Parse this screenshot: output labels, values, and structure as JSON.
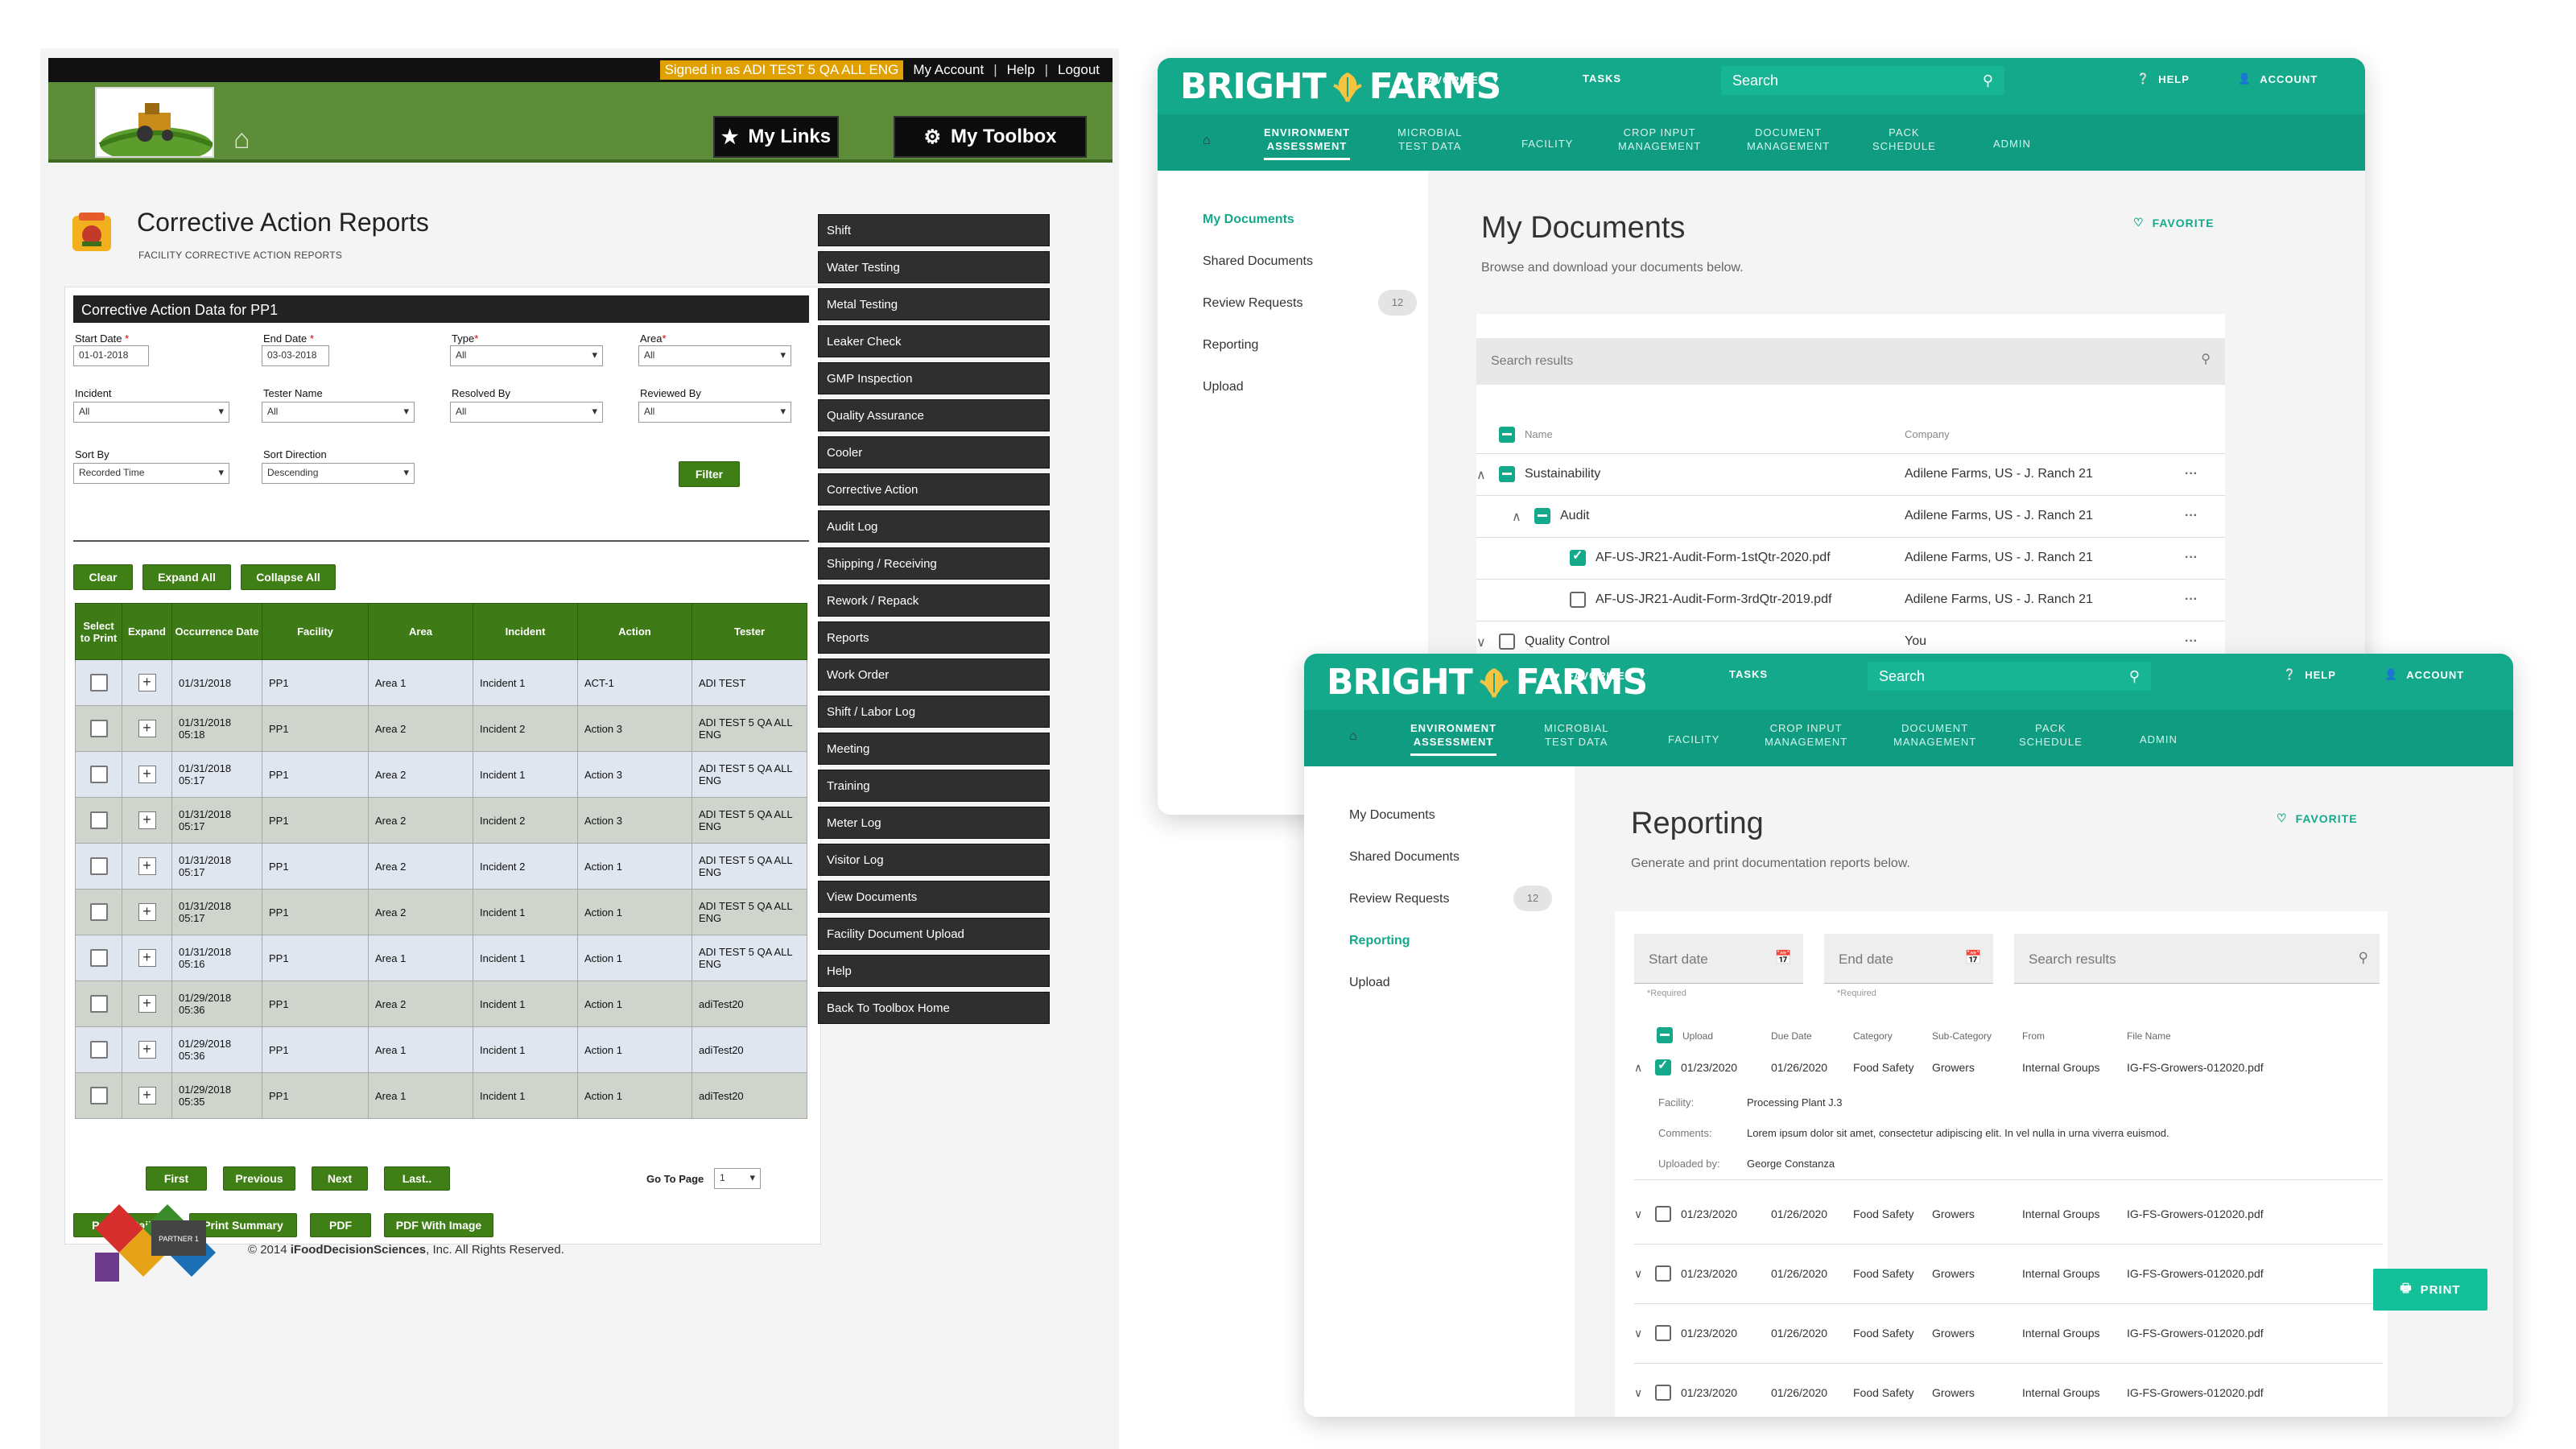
{
  "legacy": {
    "topbar": {
      "signed": "Signed in as ADI TEST 5 QA ALL ENG",
      "account": "My Account",
      "help": "Help",
      "logout": "Logout"
    },
    "mylinks": "My Links",
    "mytoolbox": "My Toolbox",
    "title": "Corrective Action Reports",
    "subtitle": "FACILITY CORRECTIVE ACTION REPORTS",
    "form_header": "Corrective Action Data for PP1",
    "fields": {
      "start_label": "Start Date",
      "start_value": "01-01-2018",
      "end_label": "End Date",
      "end_value": "03-03-2018",
      "type_label": "Type",
      "type_value": "All",
      "area_label": "Area",
      "area_value": "All",
      "incident_label": "Incident",
      "incident_value": "All",
      "tester_label": "Tester Name",
      "tester_value": "All",
      "resolved_label": "Resolved By",
      "resolved_value": "All",
      "reviewed_label": "Reviewed By",
      "reviewed_value": "All",
      "sortby_label": "Sort By",
      "sortby_value": "Recorded Time",
      "sortdir_label": "Sort Direction",
      "sortdir_value": "Descending",
      "required_mark": "*"
    },
    "buttons": {
      "filter": "Filter",
      "clear": "Clear",
      "expand": "Expand All",
      "collapse": "Collapse All",
      "first": "First",
      "previous": "Previous",
      "next": "Next",
      "last": "Last..",
      "print_details": "Print Details",
      "print_summary": "Print Summary",
      "pdf": "PDF",
      "pdf_image": "PDF With Image"
    },
    "table": {
      "headers": [
        "Select to Print",
        "Expand",
        "Occurrence Date",
        "Facility",
        "Area",
        "Incident",
        "Action",
        "Tester"
      ],
      "rows": [
        {
          "date": "01/31/2018",
          "time": "",
          "facility": "PP1",
          "area": "Area 1",
          "incident": "Incident 1",
          "action": "ACT-1",
          "tester": "ADI TEST"
        },
        {
          "date": "01/31/2018",
          "time": "05:18",
          "facility": "PP1",
          "area": "Area 2",
          "incident": "Incident 2",
          "action": "Action 3",
          "tester": "ADI TEST 5 QA ALL ENG"
        },
        {
          "date": "01/31/2018",
          "time": "05:17",
          "facility": "PP1",
          "area": "Area 2",
          "incident": "Incident 1",
          "action": "Action 3",
          "tester": "ADI TEST 5 QA ALL ENG"
        },
        {
          "date": "01/31/2018",
          "time": "05:17",
          "facility": "PP1",
          "area": "Area 2",
          "incident": "Incident 2",
          "action": "Action 3",
          "tester": "ADI TEST 5 QA ALL ENG"
        },
        {
          "date": "01/31/2018",
          "time": "05:17",
          "facility": "PP1",
          "area": "Area 2",
          "incident": "Incident 2",
          "action": "Action 1",
          "tester": "ADI TEST 5 QA ALL ENG"
        },
        {
          "date": "01/31/2018",
          "time": "05:17",
          "facility": "PP1",
          "area": "Area 2",
          "incident": "Incident 1",
          "action": "Action 1",
          "tester": "ADI TEST 5 QA ALL ENG"
        },
        {
          "date": "01/31/2018",
          "time": "05:16",
          "facility": "PP1",
          "area": "Area 1",
          "incident": "Incident 1",
          "action": "Action 1",
          "tester": "ADI TEST 5 QA ALL ENG"
        },
        {
          "date": "01/29/2018",
          "time": "05:36",
          "facility": "PP1",
          "area": "Area 2",
          "incident": "Incident 1",
          "action": "Action 1",
          "tester": "adiTest20"
        },
        {
          "date": "01/29/2018",
          "time": "05:36",
          "facility": "PP1",
          "area": "Area 1",
          "incident": "Incident 1",
          "action": "Action 1",
          "tester": "adiTest20"
        },
        {
          "date": "01/29/2018",
          "time": "05:35",
          "facility": "PP1",
          "area": "Area 1",
          "incident": "Incident 1",
          "action": "Action 1",
          "tester": "adiTest20"
        }
      ]
    },
    "goto_label": "Go To Page",
    "goto_value": "1",
    "toolbox_menu": [
      "Shift",
      "Water Testing",
      "Metal Testing",
      "Leaker Check",
      "GMP Inspection",
      "Quality Assurance",
      "Cooler",
      "Corrective Action",
      "Audit Log",
      "Shipping / Receiving",
      "Rework / Repack",
      "Reports",
      "Work Order",
      "Shift / Labor Log",
      "Meeting",
      "Training",
      "Meter Log",
      "Visitor Log",
      "View Documents",
      "Facility Document Upload",
      "Help",
      "Back To Toolbox Home"
    ],
    "copyright_prefix": "© 2014 ",
    "copyright_brand": "iFoodDecisionSciences",
    "copyright_suffix": ", Inc. All Rights Reserved.",
    "footer_logo_text": "PARTNER 1"
  },
  "brand": {
    "bright": "BRIGHT",
    "farms": "FARMS",
    "primary": "#14a98a"
  },
  "header": {
    "favorites": "FAVORITES",
    "tasks": "TASKS",
    "search": "Search",
    "help": "HELP",
    "account": "ACCOUNT"
  },
  "nav": [
    {
      "l1": "ENVIRONMENT",
      "l2": "ASSESSMENT"
    },
    {
      "l1": "MICROBIAL",
      "l2": "TEST DATA"
    },
    {
      "l1": "FACILITY",
      "l2": ""
    },
    {
      "l1": "CROP INPUT",
      "l2": "MANAGEMENT"
    },
    {
      "l1": "DOCUMENT",
      "l2": "MANAGEMENT"
    },
    {
      "l1": "PACK",
      "l2": "SCHEDULE"
    },
    {
      "l1": "ADMIN",
      "l2": ""
    }
  ],
  "sidebar": {
    "my_documents": "My Documents",
    "shared_documents": "Shared Documents",
    "review_requests": "Review Requests",
    "review_count": "12",
    "reporting": "Reporting",
    "upload": "Upload"
  },
  "favorite_label": "FAVORITE",
  "docs": {
    "title": "My Documents",
    "subtitle": "Browse and download your documents below.",
    "search_placeholder": "Search results",
    "col_name": "Name",
    "col_company": "Company",
    "rows": [
      {
        "name": "Sustainability",
        "company": "Adilene Farms, US - J. Ranch 21"
      },
      {
        "name": "Audit",
        "company": "Adilene Farms, US - J. Ranch 21"
      },
      {
        "name": "AF-US-JR21-Audit-Form-1stQtr-2020.pdf",
        "company": "Adilene Farms, US - J. Ranch 21"
      },
      {
        "name": "AF-US-JR21-Audit-Form-3rdQtr-2019.pdf",
        "company": "Adilene Farms, US - J. Ranch 21"
      },
      {
        "name": "Quality Control",
        "company": "You"
      }
    ]
  },
  "reporting": {
    "title": "Reporting",
    "subtitle": "Generate and print documentation reports below.",
    "start_placeholder": "Start date",
    "end_placeholder": "End date",
    "search_placeholder": "Search results",
    "required": "*Required",
    "headers": {
      "upload": "Upload",
      "due": "Due Date",
      "category": "Category",
      "subcategory": "Sub-Category",
      "from": "From",
      "file": "File Name"
    },
    "rows": [
      {
        "upload": "01/23/2020",
        "due": "01/26/2020",
        "category": "Food Safety",
        "subcategory": "Growers",
        "from": "Internal Groups",
        "file": "IG-FS-Growers-012020.pdf"
      },
      {
        "upload": "01/23/2020",
        "due": "01/26/2020",
        "category": "Food Safety",
        "subcategory": "Growers",
        "from": "Internal Groups",
        "file": "IG-FS-Growers-012020.pdf"
      },
      {
        "upload": "01/23/2020",
        "due": "01/26/2020",
        "category": "Food Safety",
        "subcategory": "Growers",
        "from": "Internal Groups",
        "file": "IG-FS-Growers-012020.pdf"
      },
      {
        "upload": "01/23/2020",
        "due": "01/26/2020",
        "category": "Food Safety",
        "subcategory": "Growers",
        "from": "Internal Groups",
        "file": "IG-FS-Growers-012020.pdf"
      },
      {
        "upload": "01/23/2020",
        "due": "01/26/2020",
        "category": "Food Safety",
        "subcategory": "Growers",
        "from": "Internal Groups",
        "file": "IG-FS-Growers-012020.pdf"
      }
    ],
    "detail": {
      "facility_label": "Facility:",
      "facility_value": "Processing Plant J.3",
      "comments_label": "Comments:",
      "comments_value": "Lorem ipsum dolor sit amet, consectetur adipiscing elit. In vel nulla in urna viverra euismod.",
      "uploaded_label": "Uploaded by:",
      "uploaded_value": "George Constanza"
    },
    "print": "PRINT"
  }
}
